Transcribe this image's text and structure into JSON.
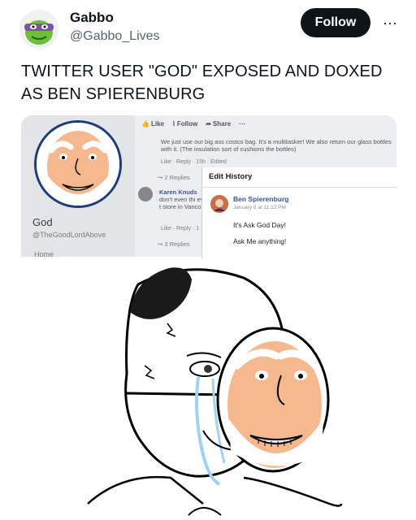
{
  "user": {
    "name": "Gabbo",
    "handle": "@Gabbo_Lives"
  },
  "header": {
    "follow_label": "Follow",
    "more_label": "···"
  },
  "tweet": {
    "text": "TWITTER USER \"GOD\" EXPOSED AND DOXED AS BEN SPIERENBURG"
  },
  "screenshot": {
    "profile": {
      "name": "God",
      "handle": "@TheGoodLordAbove",
      "home": "Home"
    },
    "actions": [
      "Like",
      "Follow",
      "Share",
      "···"
    ],
    "comment": "We just use our big ass costco bag. It's a multitasker! We also return our glass bottles with it. (The insulation sort of cushions the bottles)",
    "comment_meta": "Like · Reply · 15h · Edited",
    "replies_1": "2 Replies",
    "karen_name": "Karen Knuds",
    "karen_text": "don't even thi even packed t store in Vanco",
    "karen_meta": "Like · Reply · 1",
    "replies_2": "3 Replies",
    "edit_history": {
      "title": "Edit History",
      "author": "Ben Spierenburg",
      "time": "January 8 at 11:12 PM",
      "version_1": "It's Ask God Day!",
      "version_2": "Ask Me anything!"
    }
  },
  "colors": {
    "text": "#0f1419",
    "secondary": "#536471",
    "follow_bg": "#0f1419",
    "fb_link": "#385898",
    "face_skin": "#f6b98f"
  }
}
